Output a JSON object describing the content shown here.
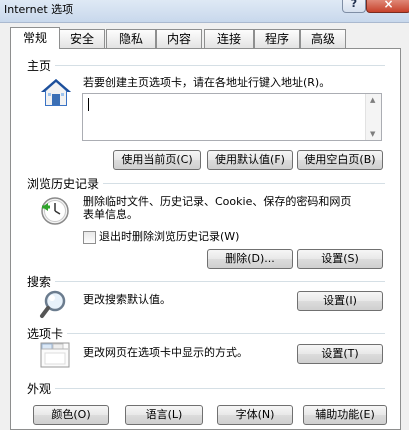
{
  "window": {
    "title": "Internet 选项",
    "help_label": "?",
    "close_label": "×"
  },
  "tabs": [
    {
      "label": "常规"
    },
    {
      "label": "安全"
    },
    {
      "label": "隐私"
    },
    {
      "label": "内容"
    },
    {
      "label": "连接"
    },
    {
      "label": "程序"
    },
    {
      "label": "高级"
    }
  ],
  "home": {
    "group_label": "主页",
    "description": "若要创建主页选项卡，请在各地址行键入地址(R)。",
    "textarea_value": "",
    "use_current": "使用当前页(C)",
    "use_default": "使用默认值(F)",
    "use_blank": "使用空白页(B)"
  },
  "history": {
    "group_label": "浏览历史记录",
    "description_line1": "删除临时文件、历史记录、Cookie、保存的密码和网页",
    "description_line2": "表单信息。",
    "checkbox_label": "退出时删除浏览历史记录(W)",
    "delete_button": "删除(D)...",
    "settings_button": "设置(S)"
  },
  "search": {
    "group_label": "搜索",
    "description": "更改搜索默认值。",
    "settings_button": "设置(I)"
  },
  "tabs_section": {
    "group_label": "选项卡",
    "description": "更改网页在选项卡中显示的方式。",
    "settings_button": "设置(T)"
  },
  "appearance": {
    "group_label": "外观",
    "colors_button": "颜色(O)",
    "languages_button": "语言(L)",
    "fonts_button": "字体(N)",
    "accessibility_button": "辅助功能(E)"
  }
}
